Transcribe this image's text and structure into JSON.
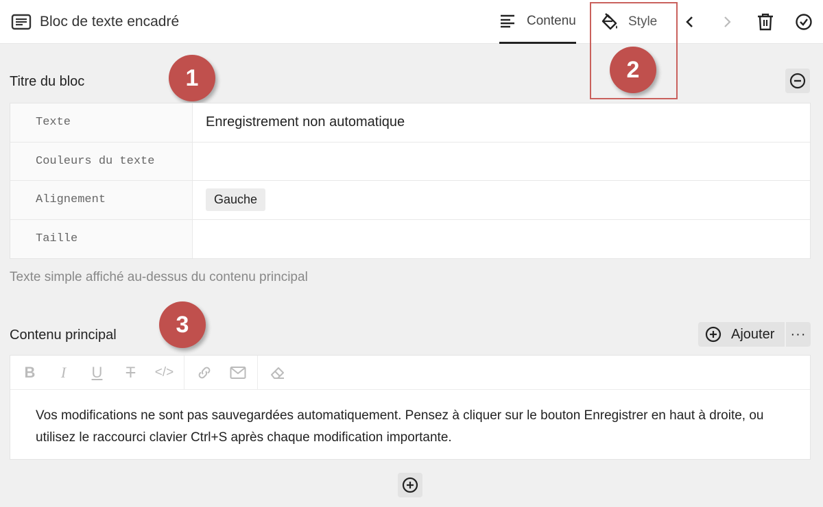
{
  "header": {
    "title": "Bloc de texte encadré",
    "tabs": [
      {
        "label": "Contenu",
        "icon": "align-left-icon",
        "active": true
      },
      {
        "label": "Style",
        "icon": "paint-bucket-icon",
        "active": false
      }
    ],
    "actions": [
      "chevron-left-icon",
      "chevron-right-icon",
      "trash-icon",
      "check-circle-icon"
    ]
  },
  "annotations": [
    "1",
    "2",
    "3"
  ],
  "section_title": {
    "label": "Titre du bloc",
    "properties": [
      {
        "key": "Texte",
        "value": "Enregistrement non automatique"
      },
      {
        "key": "Couleurs du texte",
        "value": ""
      },
      {
        "key": "Alignement",
        "value": "Gauche"
      },
      {
        "key": "Taille",
        "value": ""
      }
    ],
    "help": "Texte simple affiché au-dessus du contenu principal"
  },
  "section_main": {
    "label": "Contenu principal",
    "add_label": "Ajouter",
    "more_label": "···",
    "toolbar": {
      "bold": "B",
      "italic": "I",
      "underline": "U",
      "strike": "T",
      "code": "</>"
    },
    "body": "Vos modifications ne sont pas sauvegardées automatiquement. Pensez à cliquer sur le bouton Enregistrer en haut à droite, ou utilisez le raccourci clavier Ctrl+S après chaque modification importante."
  },
  "colors": {
    "accent": "#c0504d",
    "background": "#f0f0f0"
  }
}
